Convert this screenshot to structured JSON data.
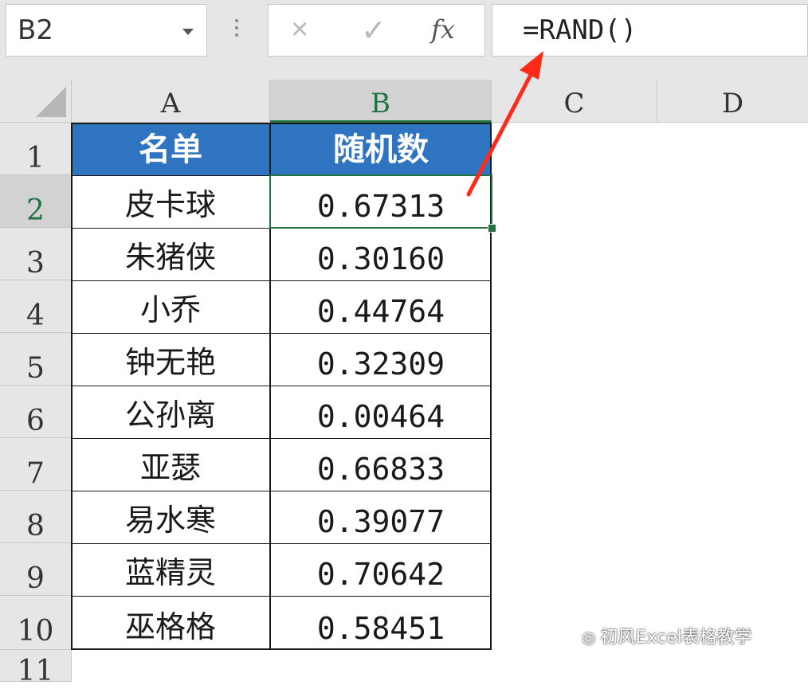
{
  "name_box": {
    "value": "B2"
  },
  "formula_bar": {
    "cancel_icon": "×",
    "enter_icon": "✓",
    "fx_label": "fx",
    "formula": "=RAND()"
  },
  "columns": [
    "A",
    "B",
    "C",
    "D"
  ],
  "selected_cell": "B2",
  "table": {
    "headers": [
      "名单",
      "随机数"
    ],
    "rows": [
      {
        "row": "2",
        "name": "皮卡球",
        "value": "0.67313"
      },
      {
        "row": "3",
        "name": "朱猪侠",
        "value": "0.30160"
      },
      {
        "row": "4",
        "name": "小乔",
        "value": "0.44764"
      },
      {
        "row": "5",
        "name": "钟无艳",
        "value": "0.32309"
      },
      {
        "row": "6",
        "name": "公孙离",
        "value": "0.00464"
      },
      {
        "row": "7",
        "name": "亚瑟",
        "value": "0.66833"
      },
      {
        "row": "8",
        "name": "易水寒",
        "value": "0.39077"
      },
      {
        "row": "9",
        "name": "蓝精灵",
        "value": "0.70642"
      },
      {
        "row": "10",
        "name": "巫格格",
        "value": "0.58451"
      }
    ]
  },
  "row_labels": [
    "1",
    "2",
    "3",
    "4",
    "5",
    "6",
    "7",
    "8",
    "9",
    "10",
    "11"
  ],
  "colors": {
    "header_fill": "#2f74c0",
    "selection": "#217346",
    "arrow": "#ff2a1a"
  },
  "watermark": {
    "text": "初风Excel表格教学"
  }
}
